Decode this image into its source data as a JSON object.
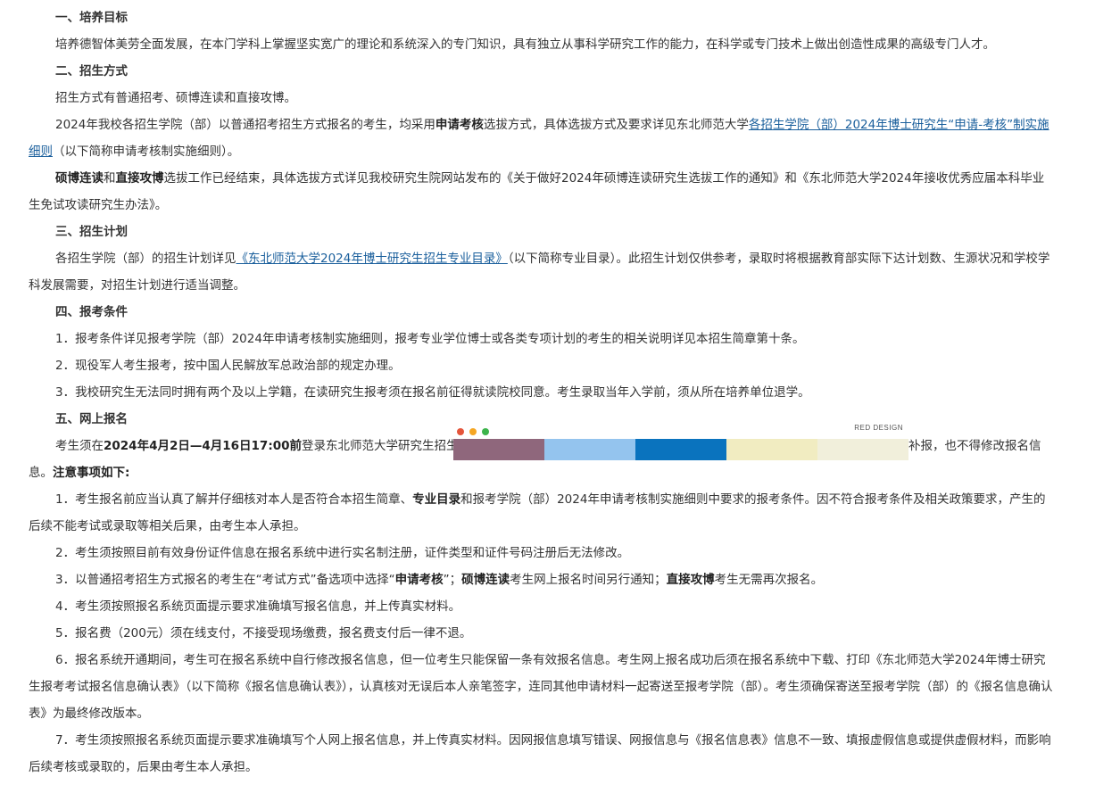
{
  "s1": {
    "title": "一、培养目标",
    "p1": "培养德智体美劳全面发展，在本门学科上掌握坚实宽广的理论和系统深入的专门知识，具有独立从事科学研究工作的能力，在科学或专门技术上做出创造性成果的高级专门人才。"
  },
  "s2": {
    "title": "二、招生方式",
    "p1": "招生方式有普通招考、硕博连读和直接攻博。",
    "p2a": "2024年我校各招生学院（部）以普通招考招生方式报名的考生，均采用",
    "p2b": "申请考核",
    "p2c": "选拔方式，具体选拔方式及要求详见东北师范大学",
    "p2link": "各招生学院（部）2024年博士研究生“申请-考核”制实施细则",
    "p2d": "（以下简称申请考核制实施细则）。",
    "p3a": "硕博连读",
    "p3b": "和",
    "p3c": "直接攻博",
    "p3d": "选拔工作已经结束，具体选拔方式详见我校研究生院网站发布的",
    "p3e": "《关于做好2024年硕博连读研究生选拔工作的通知》",
    "p3f": "和",
    "p3g": "《东北师范大学2024年接收优秀应届本科毕业生免试攻读研究生办法》",
    "p3h": "。"
  },
  "s3": {
    "title": "三、招生计划",
    "p1a": "各招生学院（部）的招生计划详见",
    "p1link": "《东北师范大学2024年博士研究生招生专业目录》",
    "p1b": "（以下简称专业目录）。此招生计划仅供参考，录取时将根据教育部实际下达计划数、生源状况和学校学科发展需要，对招生计划进行适当调整。"
  },
  "s4": {
    "title": "四、报考条件",
    "items": [
      "1．报考条件详见报考学院（部）2024年申请考核制实施细则，报考专业学位博士或各类专项计划的考生的相关说明详见本招生简章第十条。",
      "2．现役军人考生报考，按中国人民解放军总政治部的规定办理。",
      "3．我校研究生无法同时拥有两个及以上学籍，在读研究生报考须在报名前征得就读院校同意。考生录取当年入学前，须从所在培养单位退学。"
    ]
  },
  "s5": {
    "title": "五、网上报名",
    "p1a": "考生须在",
    "p1b": "2024年4月2日—4月16日17:00前",
    "p1c": "登录东北师范大学研究生招生",
    "p1d": "报名，逾期不能补报，也不得修改报名信息。",
    "p1e": "注意事项如下:",
    "n1a": "1．考生报名前应当认真了解并仔细核对本人是否符合本招生简章、",
    "n1b": "专业目录",
    "n1c": "和报考学院（部）2024年申请考核制实施细则中要求的报考条件。因不符合报考条件及相关政策要求，产生的后续不能考试或录取等相关后果，由考生本人承担。",
    "n2": "2．考生须按照目前有效身份证件信息在报名系统中进行实名制注册，证件类型和证件号码注册后无法修改。",
    "n3a": "3．以普通招考招生方式报名的考生在“考试方式”备选项中选择“",
    "n3b": "申请考核",
    "n3c": "”；",
    "n3d": "硕博连读",
    "n3e": "考生网上报名时间另行通知；",
    "n3f": "直接攻博",
    "n3g": "考生无需再次报名。",
    "n4": "4．考生须按照报名系统页面提示要求准确填写报名信息，并上传真实材料。",
    "n5": "5．报名费（200元）须在线支付，不接受现场缴费，报名费支付后一律不退。",
    "n6": "6．报名系统开通期间，考生可在报名系统中自行修改报名信息，但一位考生只能保留一条有效报名信息。考生网上报名成功后须在报名系统中下载、打印《东北师范大学2024年博士研究生报考考试报名信息确认表》（以下简称《报名信息确认表》），认真核对无误后本人亲笔签字，连同其他申请材料一起寄送至报考学院（部）。考生须确保寄送至报考学院（部）的《报名信息确认表》为最终修改版本。",
    "n7": "7．考生须按照报名系统页面提示要求准确填写个人网上报名信息，并上传真实材料。因网报信息填写错误、网报信息与《报名信息表》信息不一致、填报虚假信息或提供虚假材料，而影响后续考核或录取的，后果由考生本人承担。"
  },
  "overlay": {
    "brand": "RED DESIGN",
    "dot_colors": [
      "#e5553b",
      "#f5a623",
      "#3cb44b"
    ],
    "swatches": [
      "#8f677c",
      "#94c4ee",
      "#0a73be",
      "#f1ecc1",
      "#f1efdb"
    ]
  }
}
